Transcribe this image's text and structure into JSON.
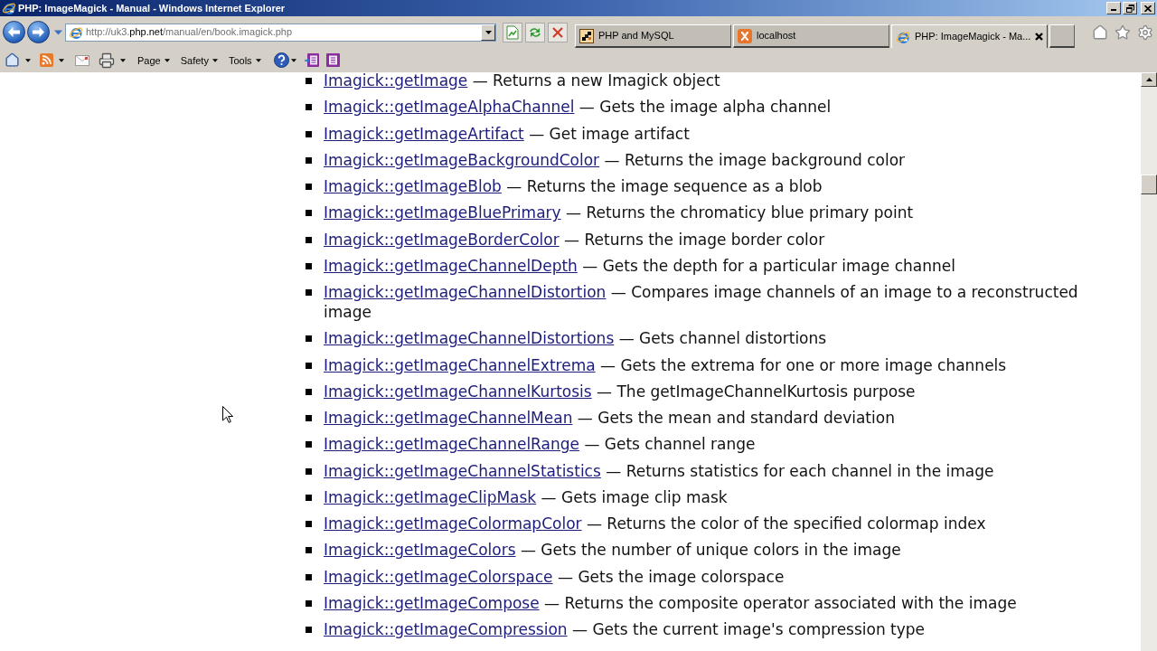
{
  "window": {
    "title": "PHP: ImageMagick - Manual - Windows Internet Explorer"
  },
  "address_bar": {
    "url": [
      {
        "text": "http://uk3.",
        "highlight": false
      },
      {
        "text": "php.net",
        "highlight": true
      },
      {
        "text": "/manual/en/book.imagick.php",
        "highlight": false
      }
    ]
  },
  "tabs": [
    {
      "title": "PHP and MySQL",
      "selected": false
    },
    {
      "title": "localhost",
      "selected": false
    },
    {
      "title": "PHP: ImageMagick - Ma...",
      "selected": true
    }
  ],
  "command_bar": {
    "menus": [
      "Page",
      "Safety",
      "Tools"
    ]
  },
  "functions": [
    {
      "name": "Imagick::getImage",
      "description": "— Returns a new Imagick object"
    },
    {
      "name": "Imagick::getImageAlphaChannel",
      "description": "— Gets the image alpha channel"
    },
    {
      "name": "Imagick::getImageArtifact",
      "description": "— Get image artifact"
    },
    {
      "name": "Imagick::getImageBackgroundColor",
      "description": "— Returns the image background color"
    },
    {
      "name": "Imagick::getImageBlob",
      "description": "— Returns the image sequence as a blob"
    },
    {
      "name": "Imagick::getImageBluePrimary",
      "description": "— Returns the chromaticy blue primary point"
    },
    {
      "name": "Imagick::getImageBorderColor",
      "description": "— Returns the image border color"
    },
    {
      "name": "Imagick::getImageChannelDepth",
      "description": "— Gets the depth for a particular image channel"
    },
    {
      "name": "Imagick::getImageChannelDistortion",
      "description": "— Compares image channels of an image to a reconstructed image"
    },
    {
      "name": "Imagick::getImageChannelDistortions",
      "description": "— Gets channel distortions"
    },
    {
      "name": "Imagick::getImageChannelExtrema",
      "description": "— Gets the extrema for one or more image channels"
    },
    {
      "name": "Imagick::getImageChannelKurtosis",
      "description": "— The getImageChannelKurtosis purpose"
    },
    {
      "name": "Imagick::getImageChannelMean",
      "description": "— Gets the mean and standard deviation"
    },
    {
      "name": "Imagick::getImageChannelRange",
      "description": "— Gets channel range"
    },
    {
      "name": "Imagick::getImageChannelStatistics",
      "description": "— Returns statistics for each channel in the image"
    },
    {
      "name": "Imagick::getImageClipMask",
      "description": "— Gets image clip mask"
    },
    {
      "name": "Imagick::getImageColormapColor",
      "description": "— Returns the color of the specified colormap index"
    },
    {
      "name": "Imagick::getImageColors",
      "description": "— Gets the number of unique colors in the image"
    },
    {
      "name": "Imagick::getImageColorspace",
      "description": "— Gets the image colorspace"
    },
    {
      "name": "Imagick::getImageCompose",
      "description": "— Returns the composite operator associated with the image"
    },
    {
      "name": "Imagick::getImageCompression",
      "description": "— Gets the current image's compression type"
    }
  ]
}
